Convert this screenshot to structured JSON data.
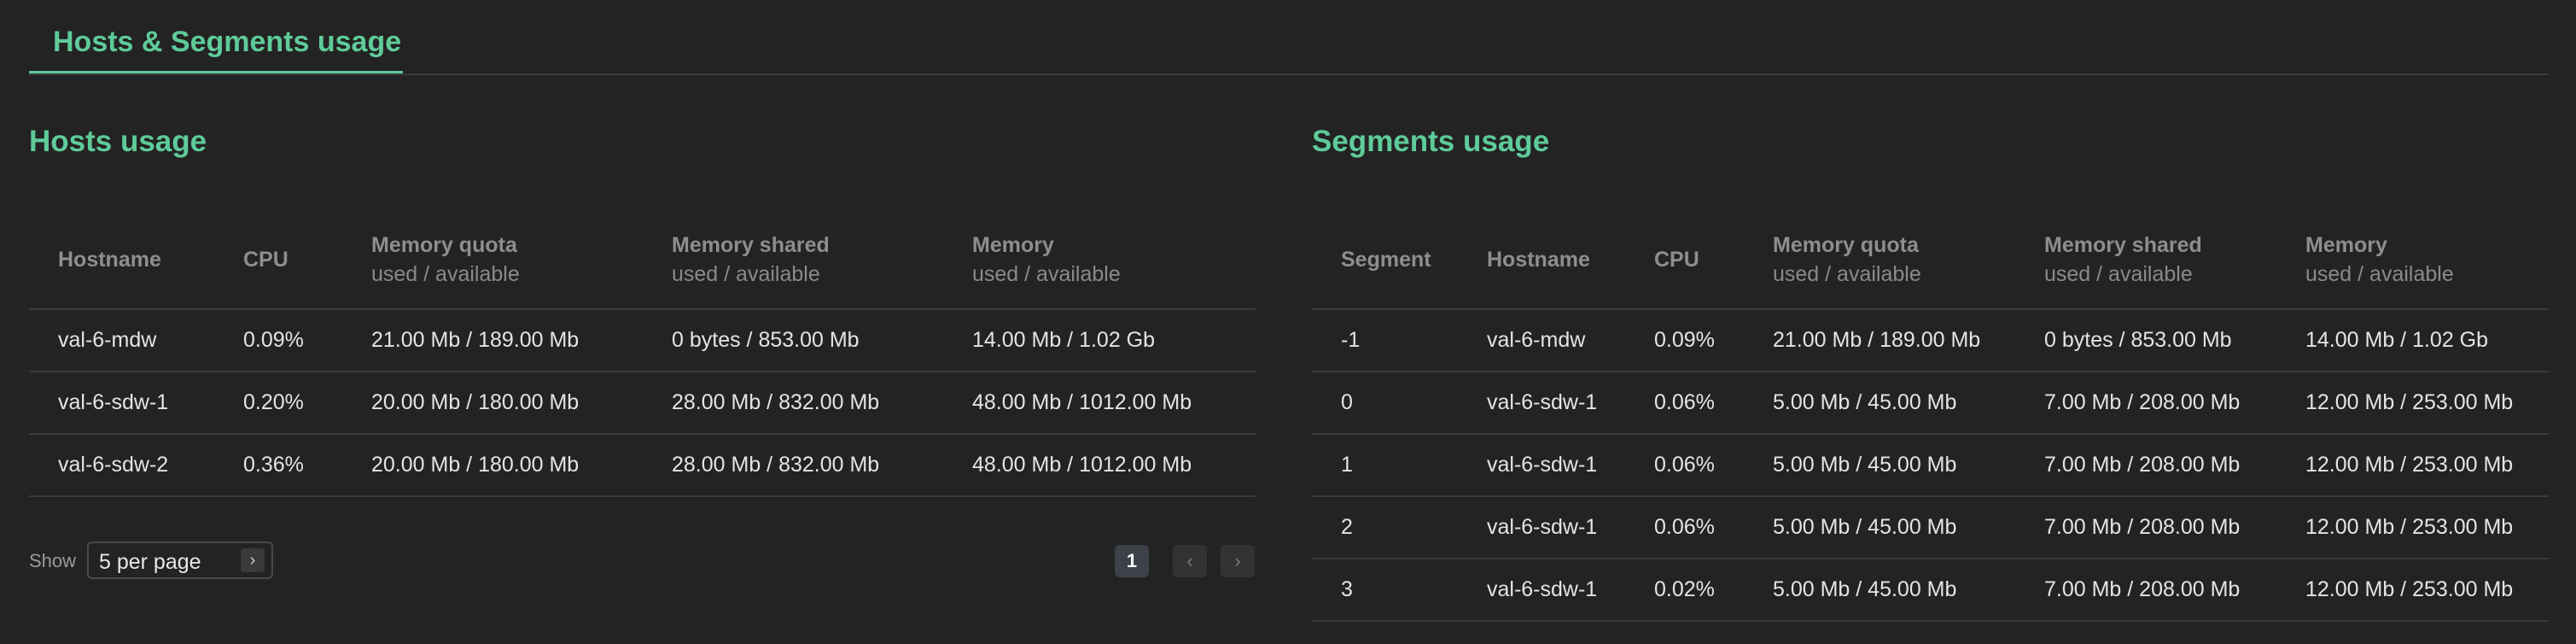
{
  "tabs": {
    "active_label": "Hosts & Segments usage"
  },
  "hosts": {
    "title": "Hosts usage",
    "columns": [
      {
        "label": "Hostname",
        "sub": ""
      },
      {
        "label": "CPU",
        "sub": ""
      },
      {
        "label": "Memory quota",
        "sub": "used / available"
      },
      {
        "label": "Memory shared",
        "sub": "used / available"
      },
      {
        "label": "Memory",
        "sub": "used / available"
      }
    ],
    "rows": [
      [
        "val-6-mdw",
        "0.09%",
        "21.00 Mb / 189.00 Mb",
        "0 bytes / 853.00 Mb",
        "14.00 Mb / 1.02 Gb"
      ],
      [
        "val-6-sdw-1",
        "0.20%",
        "20.00 Mb / 180.00 Mb",
        "28.00 Mb / 832.00 Mb",
        "48.00 Mb / 1012.00 Mb"
      ],
      [
        "val-6-sdw-2",
        "0.36%",
        "20.00 Mb / 180.00 Mb",
        "28.00 Mb / 832.00 Mb",
        "48.00 Mb / 1012.00 Mb"
      ]
    ],
    "pagination": {
      "show_label": "Show",
      "per_page": "5 per page",
      "current_page": "1",
      "prev_icon": "chevron-left-icon",
      "next_icon": "chevron-right-icon"
    }
  },
  "segments": {
    "title": "Segments usage",
    "columns": [
      {
        "label": "Segment",
        "sub": ""
      },
      {
        "label": "Hostname",
        "sub": ""
      },
      {
        "label": "CPU",
        "sub": ""
      },
      {
        "label": "Memory quota",
        "sub": "used / available"
      },
      {
        "label": "Memory shared",
        "sub": "used / available"
      },
      {
        "label": "Memory",
        "sub": "used / available"
      }
    ],
    "rows": [
      [
        "-1",
        "val-6-mdw",
        "0.09%",
        "21.00 Mb / 189.00 Mb",
        "0 bytes / 853.00 Mb",
        "14.00 Mb / 1.02 Gb"
      ],
      [
        "0",
        "val-6-sdw-1",
        "0.06%",
        "5.00 Mb / 45.00 Mb",
        "7.00 Mb / 208.00 Mb",
        "12.00 Mb / 253.00 Mb"
      ],
      [
        "1",
        "val-6-sdw-1",
        "0.06%",
        "5.00 Mb / 45.00 Mb",
        "7.00 Mb / 208.00 Mb",
        "12.00 Mb / 253.00 Mb"
      ],
      [
        "2",
        "val-6-sdw-1",
        "0.06%",
        "5.00 Mb / 45.00 Mb",
        "7.00 Mb / 208.00 Mb",
        "12.00 Mb / 253.00 Mb"
      ],
      [
        "3",
        "val-6-sdw-1",
        "0.02%",
        "5.00 Mb / 45.00 Mb",
        "7.00 Mb / 208.00 Mb",
        "12.00 Mb / 253.00 Mb"
      ]
    ]
  },
  "colors": {
    "accent": "#5ecb99",
    "background": "#232323",
    "divider": "#3a3a3a"
  }
}
